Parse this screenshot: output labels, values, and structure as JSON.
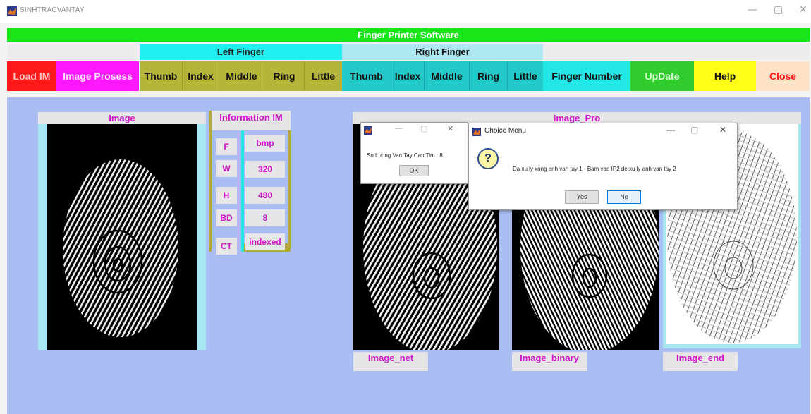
{
  "window": {
    "title": "SINHTRACVANTAY",
    "controls": [
      "—",
      "▢",
      "✕"
    ]
  },
  "banner": {
    "title": "Finger Printer Software"
  },
  "groups": {
    "left": "Left Finger",
    "right": "Right Finger"
  },
  "buttons": {
    "load": "Load IM",
    "process": "Image Prosess",
    "left_fingers": [
      "Thumb",
      "Index",
      "Middle",
      "Ring",
      "Little"
    ],
    "right_fingers": [
      "Thumb",
      "Index",
      "Middle",
      "Ring",
      "Little"
    ],
    "finger_number": "Finger Number",
    "update": "UpDate",
    "help": "Help",
    "close": "Close"
  },
  "panels": {
    "image_label": "Image",
    "info_title": "Information IM",
    "info_rows": [
      {
        "key": "F",
        "value": "bmp"
      },
      {
        "key": "W",
        "value": "320"
      },
      {
        "key": "H",
        "value": "480"
      },
      {
        "key": "BD",
        "value": "8"
      },
      {
        "key": "CT",
        "value": "indexed"
      }
    ],
    "image_pro_label": "Image_Pro",
    "image_net_label": "Image_net",
    "image_binary_label": "Image_binary",
    "image_end_label": "Image_end"
  },
  "dialog_count": {
    "message": "So Luong Van Tay Can Tim : 8",
    "ok": "OK",
    "controls": [
      "—",
      "▢",
      "✕"
    ]
  },
  "dialog_choice": {
    "title": "Choice Menu",
    "icon_glyph": "?",
    "message": "Da xu ly xong anh van tay 1 - Bam vao IP2 de xu ly anh van tay 2",
    "yes": "Yes",
    "no": "No",
    "controls": [
      "—",
      "▢",
      "✕"
    ]
  },
  "colors": {
    "banner": "#19e619",
    "group_header": "#1ef0f0",
    "load": "#ff1a1a",
    "process": "#ff19ff",
    "left_finger_btn": "#b5b53a",
    "right_finger_btn": "#23c9c9",
    "finger_number": "#23e6e6",
    "update": "#33cc2e",
    "help": "#ffff1a",
    "close": "#fde2c6",
    "main_bg": "#a9bdf3",
    "label_text": "#d012c9"
  }
}
